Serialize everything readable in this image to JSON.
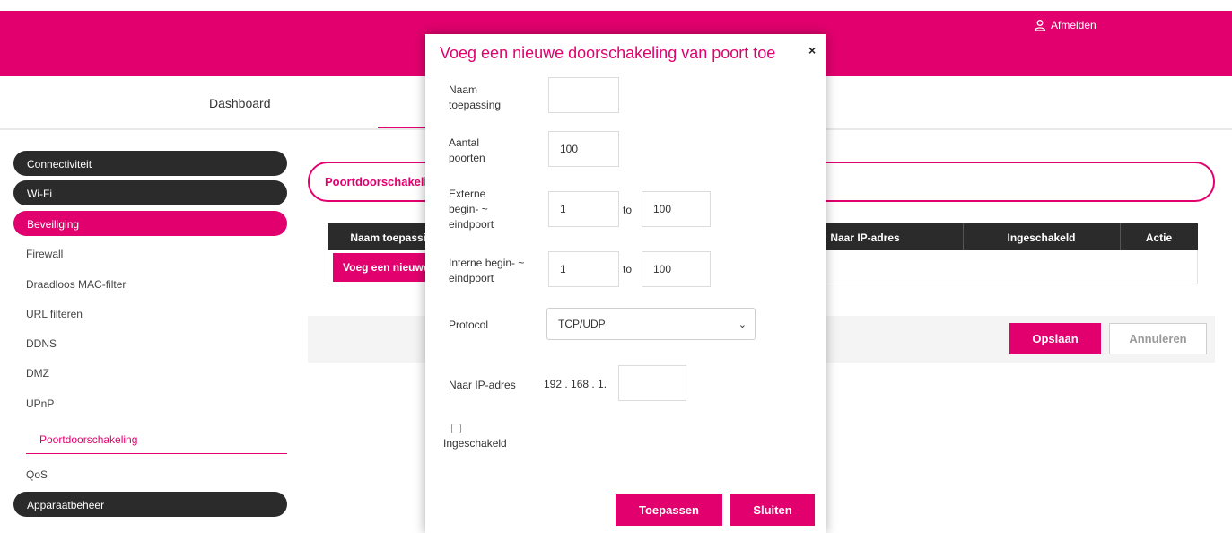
{
  "header": {
    "logout_label": "Afmelden"
  },
  "nav": {
    "tabs": [
      {
        "label": "Dashboard"
      }
    ]
  },
  "sidebar": {
    "sections": [
      {
        "label": "Connectiviteit"
      },
      {
        "label": "Wi-Fi"
      },
      {
        "label": "Beveiliging"
      },
      {
        "label": "Apparaatbeheer"
      }
    ],
    "subitems": [
      {
        "label": "Firewall"
      },
      {
        "label": "Draadloos MAC-filter"
      },
      {
        "label": "URL filteren"
      },
      {
        "label": "DDNS"
      },
      {
        "label": "DMZ"
      },
      {
        "label": "UPnP"
      },
      {
        "label": "Poortdoorschakeling"
      },
      {
        "label": "QoS"
      }
    ]
  },
  "main": {
    "title": "Poortdoorschakeling",
    "table": {
      "headers": [
        "Naam toepassing",
        "Naar IP-adres",
        "Ingeschakeld",
        "Actie"
      ]
    },
    "add_button": "Voeg een nieuwe",
    "save_button": "Opslaan",
    "cancel_button": "Annuleren"
  },
  "modal": {
    "title": "Voeg een nieuwe doorschakeling van poort toe",
    "close_symbol": "×",
    "fields": {
      "app_name": {
        "label": "Naam toepassing",
        "value": ""
      },
      "port_count": {
        "label": "Aantal poorten",
        "value": "100"
      },
      "external": {
        "label": "Externe begin- ~ eindpoort",
        "start": "1",
        "end": "100"
      },
      "internal": {
        "label": "Interne begin- ~ eindpoort",
        "start": "1",
        "end": "100"
      },
      "protocol": {
        "label": "Protocol",
        "value": "TCP/UDP"
      },
      "ip": {
        "label": "Naar IP-adres",
        "prefix": "192 . 168 . 1.",
        "value": ""
      },
      "enabled": {
        "label": "Ingeschakeld",
        "checked": false
      }
    },
    "to_label": "to",
    "apply_button": "Toepassen",
    "close_button": "Sluiten"
  },
  "colors": {
    "accent": "#e2006e",
    "dark": "#2b2b2b"
  }
}
